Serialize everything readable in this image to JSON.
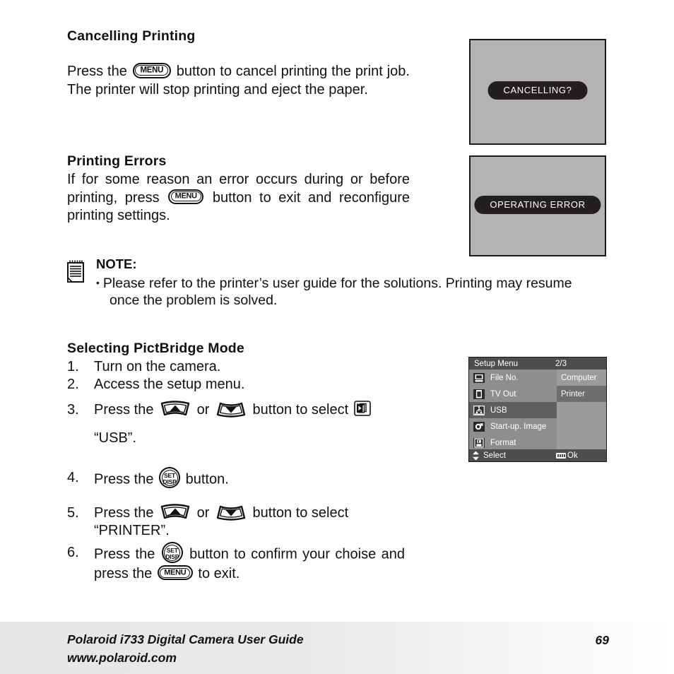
{
  "sections": {
    "cancelling": {
      "heading": "Cancelling Printing",
      "text_before_menu": "Press the",
      "text_after_menu": "button to cancel printing the print job. The printer will stop printing and eject the paper.",
      "menu_button_label": "MENU"
    },
    "printing_errors": {
      "heading": "Printing Errors",
      "text_before_menu": "If for some reason an error occurs during or before printing, press",
      "text_after_menu": "button to exit and reconfigure printing settings.",
      "menu_button_label": "MENU"
    },
    "note": {
      "title": "NOTE:",
      "bullet": "•",
      "line1": "Please refer to the printer’s user guide for the solutions. Printing may resume",
      "line2": "once the problem is solved."
    },
    "pictbridge": {
      "heading": "Selecting PictBridge Mode",
      "steps": [
        {
          "num": "1.",
          "text": "Turn on the camera."
        },
        {
          "num": "2.",
          "text": "Access the setup menu."
        },
        {
          "num": "3.",
          "part1": "Press the",
          "part2": "or",
          "part3": "button to select",
          "part4": "“USB”."
        },
        {
          "num": "4.",
          "part1": "Press the",
          "part2": "button."
        },
        {
          "num": "5.",
          "part1": "Press the",
          "part2": "or",
          "part3": "button to select",
          "part4": "“PRINTER”."
        },
        {
          "num": "6.",
          "part1": "Press the",
          "part2": "button to confirm your choise and press the",
          "part3": "to exit."
        }
      ],
      "set_button_top": "SET",
      "set_button_bottom": "DISP",
      "menu_button_label": "MENU"
    }
  },
  "lcd_previews": [
    {
      "name": "cancelling-preview",
      "message": "CANCELLING?"
    },
    {
      "name": "operating-error-preview",
      "message": "OPERATING ERROR"
    }
  ],
  "setup_menu": {
    "title": "Setup Menu",
    "page_indicator": "2/3",
    "items": [
      {
        "label": "File No.",
        "icon": "file-number-icon",
        "selected": false
      },
      {
        "label": "TV Out",
        "icon": "tv-out-icon",
        "selected": false
      },
      {
        "label": "USB",
        "icon": "usb-icon",
        "selected": true
      },
      {
        "label": "Start-up. Image",
        "icon": "startup-image-icon",
        "selected": false
      },
      {
        "label": "Format",
        "icon": "format-icon",
        "selected": false
      }
    ],
    "options": [
      {
        "label": "Computer",
        "selected": false
      },
      {
        "label": "Printer",
        "selected": true
      }
    ],
    "footer": {
      "select_label": "Select",
      "ok_label": "Ok"
    },
    "colors": {
      "titlebar": "#4d4d4d",
      "left_panel": "#8e8e8e",
      "right_panel": "#9b9b9b",
      "selected_row": "#5e5e5e",
      "selected_option": "#6e6e6e",
      "text": "#ffffff"
    }
  },
  "footer": {
    "brand": "Polaroid i733 Digital Camera User Guide",
    "url": "www.polaroid.com",
    "page_number": "69"
  }
}
